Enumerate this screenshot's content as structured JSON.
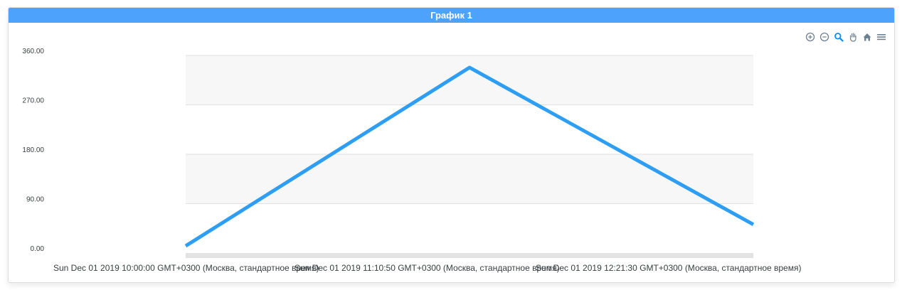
{
  "panel": {
    "title": "График 1"
  },
  "toolbar": {
    "icons": [
      "zoom-in-icon",
      "zoom-out-icon",
      "selection-zoom-icon",
      "pan-icon",
      "reset-home-icon",
      "menu-icon"
    ],
    "active_color": "#008ffb",
    "inactive_color": "#6e8192"
  },
  "colors": {
    "header": "#4da3fb",
    "series": "#2e9ef5",
    "band": "#f7f7f7",
    "grid": "#e0e0e0"
  },
  "chart_data": {
    "type": "line",
    "x": [
      "Sun Dec 01 2019 10:00:00 GMT+0300 (Москва, стандартное время)",
      "Sun Dec 01 2019 11:10:50 GMT+0300 (Москва, стандартное время)",
      "Sun Dec 01 2019 12:21:30 GMT+0300 (Москва, стандартное время)"
    ],
    "series": [
      {
        "values": [
          13,
          338,
          52
        ]
      }
    ],
    "yticks": [
      "0.00",
      "90.00",
      "180.00",
      "270.00",
      "360.00"
    ],
    "ylim": [
      0,
      360
    ],
    "grid": true,
    "legend": "none"
  }
}
